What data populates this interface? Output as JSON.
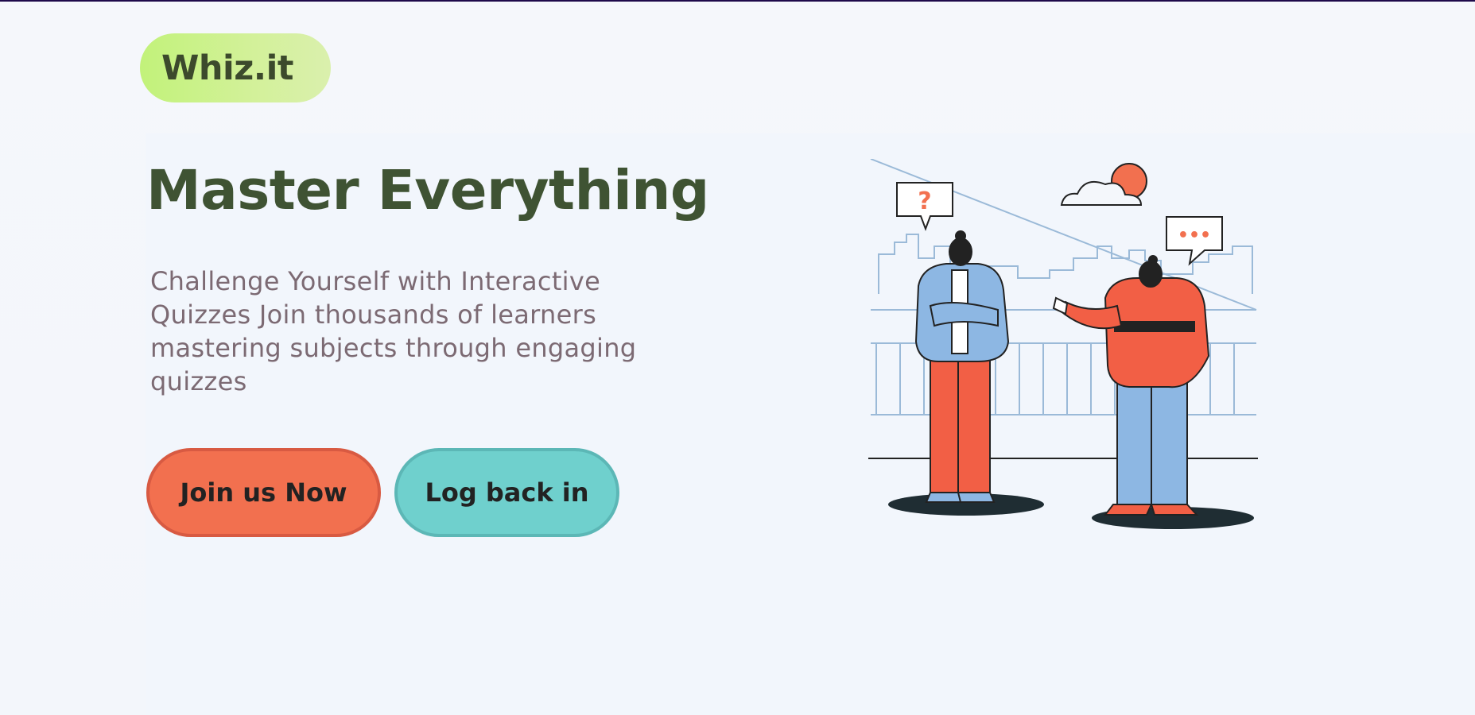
{
  "brand": {
    "logo_text": "Whiz.it"
  },
  "hero": {
    "title": "Master Everything",
    "subtitle": "Challenge Yourself with Interactive Quizzes Join thousands of learners mastering subjects through engaging quizzes",
    "join_label": "Join us Now",
    "login_label": "Log back in"
  },
  "illustration": {
    "question_bubble": "?",
    "dots_bubble": "•••"
  },
  "colors": {
    "accent_orange": "#f2704f",
    "accent_teal": "#6fd0cd",
    "logo_green": "#c2f27a",
    "title_green": "#3f5333",
    "subtitle_mauve": "#7c6a73"
  }
}
